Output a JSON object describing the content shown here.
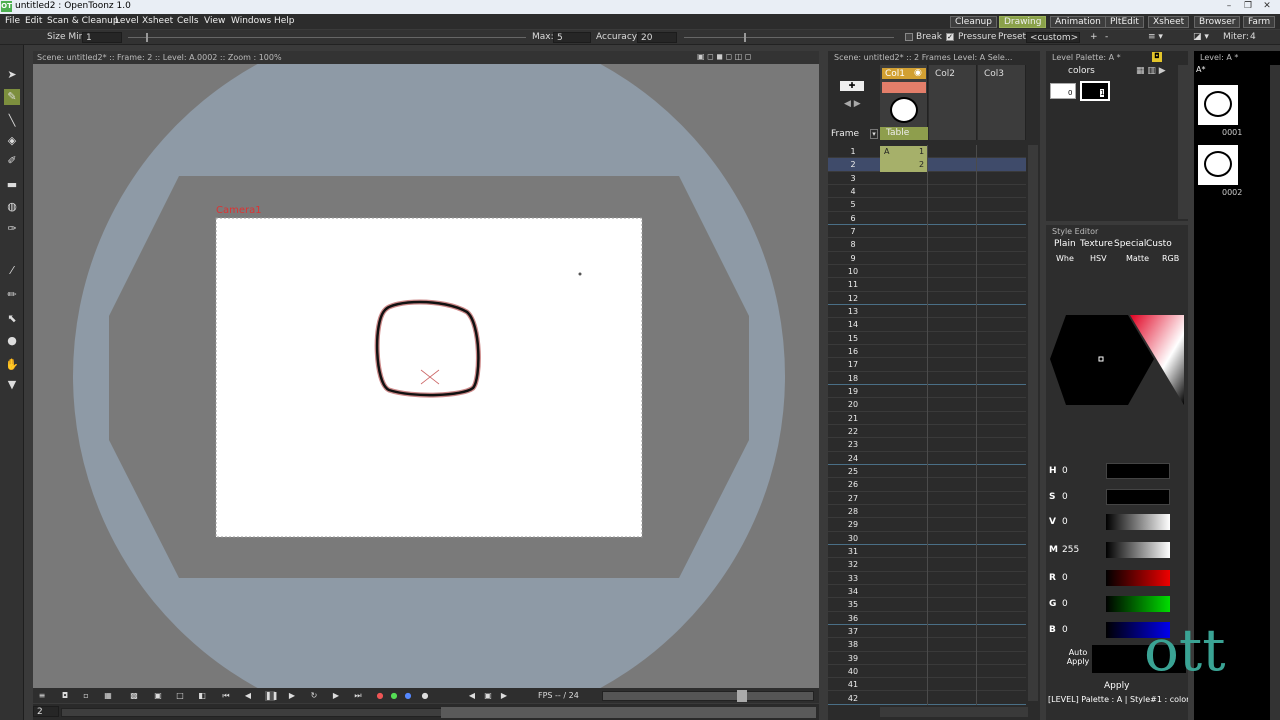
{
  "window": {
    "title": "untitled2 : OpenToonz 1.0",
    "logo": "OT"
  },
  "menu": [
    "File",
    "Edit",
    "Scan & Cleanup",
    "Level",
    "Xsheet",
    "Cells",
    "View",
    "Windows",
    "Help"
  ],
  "rooms": [
    "Cleanup",
    "Drawing",
    "Animation",
    "PltEdit",
    "Xsheet",
    "Browser",
    "Farm"
  ],
  "active_room": "Drawing",
  "tool_options": {
    "size_min_label": "Size Min:",
    "size_min": "1",
    "max_label": "Max:",
    "max": "5",
    "accuracy_label": "Accuracy:",
    "accuracy": "20",
    "break_label": "Break",
    "pressure_label": "Pressure",
    "preset_label": "Preset:",
    "preset": "<custom>",
    "miter_label": "Miter:",
    "miter": "4",
    "plus": "+",
    "minus": "-"
  },
  "viewer": {
    "header": "Scene: untitled2*  ::  Frame: 2  ::  Level: A.0002  ::  Zoom : 100%",
    "camera_label": "Camera1",
    "frame_field": "2",
    "fps": "FPS -- / 24"
  },
  "xsheet": {
    "header": "Scene: untitled2*  ::  2 Frames  Level: A  Sele...",
    "frame_label": "Frame",
    "columns": [
      "Col1",
      "Col2",
      "Col3"
    ],
    "table_label": "Table",
    "cell_1": "A",
    "cell_1_frame": "1",
    "cell_2_frame": "2",
    "rows": [
      "1",
      "2",
      "3",
      "4",
      "5",
      "6",
      "7",
      "8",
      "9",
      "10",
      "11",
      "12",
      "13",
      "14",
      "15",
      "16",
      "17",
      "18",
      "19",
      "20",
      "21",
      "22",
      "23",
      "24",
      "25",
      "26",
      "27",
      "28",
      "29",
      "30",
      "31",
      "32",
      "33",
      "34",
      "35",
      "36",
      "37",
      "38",
      "39",
      "40",
      "41",
      "42"
    ]
  },
  "level_palette": {
    "header": "Level Palette: A *",
    "tab": "colors",
    "style0": "0",
    "style1": "1"
  },
  "level_strip": {
    "header": "Level: A *",
    "level_name": "A*",
    "frames": [
      "0001",
      "0002"
    ]
  },
  "style_editor": {
    "header": "Style Editor",
    "tabs": [
      "Plain",
      "Texture",
      "Special",
      "Custo"
    ],
    "modes": [
      "Whe",
      "HSV",
      "Matte",
      "RGB"
    ],
    "channels": [
      {
        "name": "H",
        "value": "0"
      },
      {
        "name": "S",
        "value": "0"
      },
      {
        "name": "V",
        "value": "0"
      },
      {
        "name": "M",
        "value": "255"
      },
      {
        "name": "R",
        "value": "0"
      },
      {
        "name": "G",
        "value": "0"
      },
      {
        "name": "B",
        "value": "0"
      }
    ],
    "auto_apply": "Auto Apply",
    "apply": "Apply",
    "status": "[LEVEL]  Palette : A | Style#1 : color_1"
  },
  "colors": {
    "accent": "#8aa14a",
    "viewer_bg": "#797979",
    "camera_mask": "#8e9aa6",
    "red": "#d00000",
    "green": "#00b000",
    "blue": "#0000d0"
  },
  "watermark": "ott"
}
